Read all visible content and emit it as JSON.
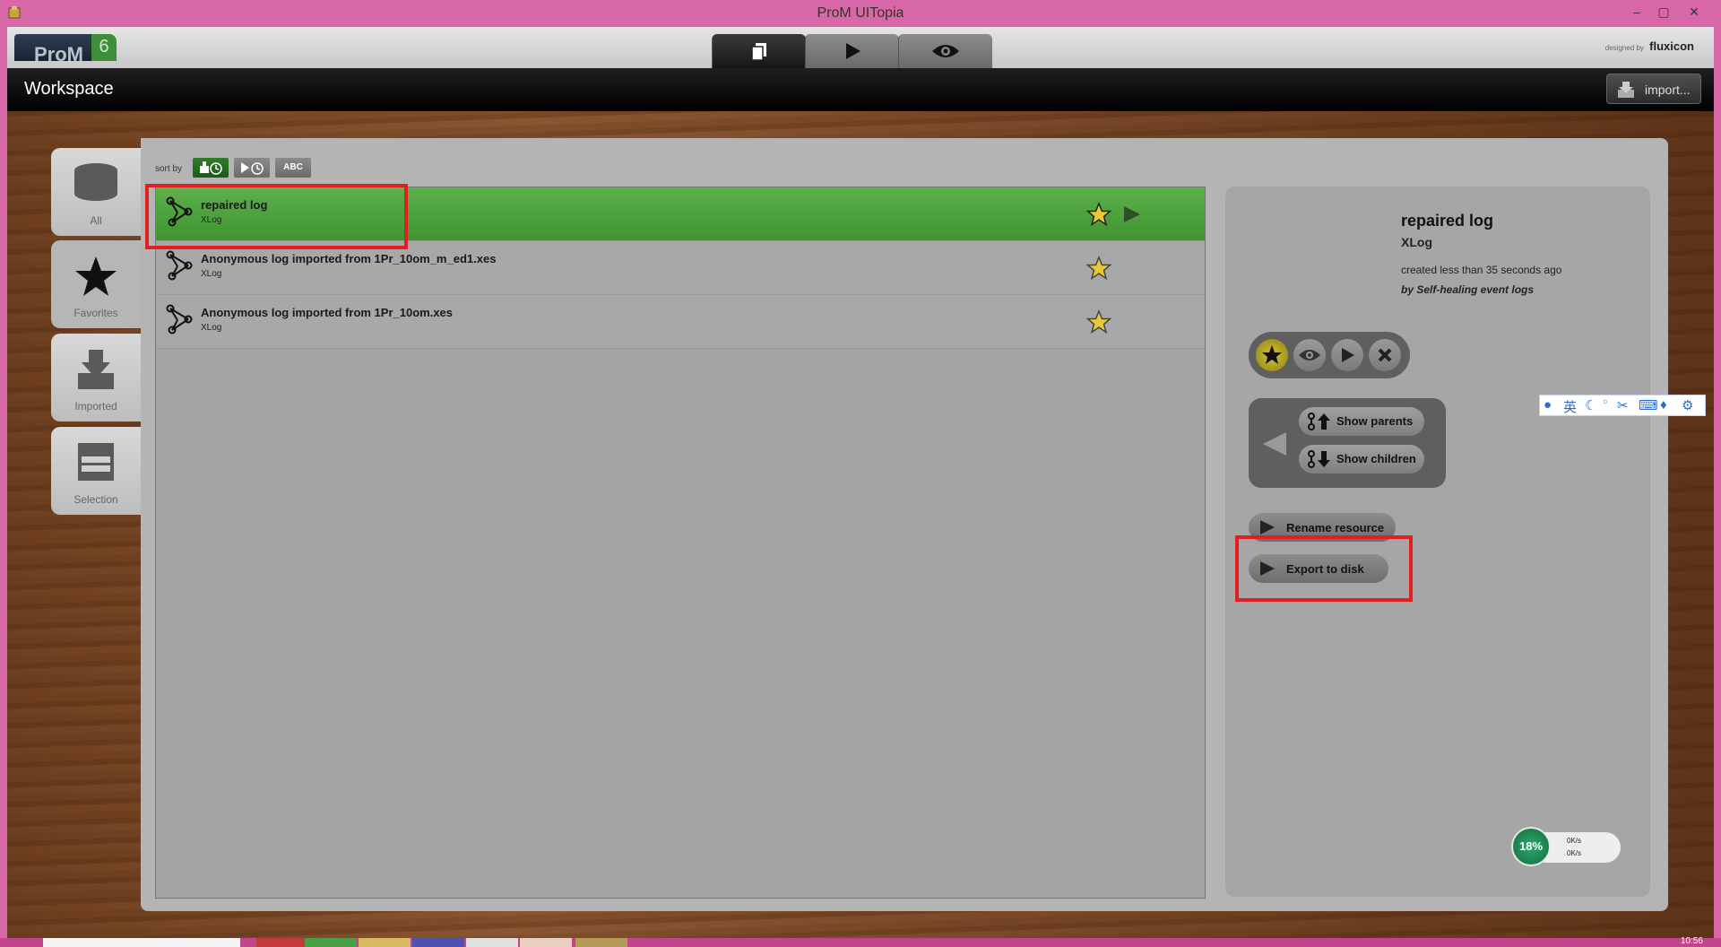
{
  "window": {
    "title": "ProM UITopia",
    "controls": [
      "–",
      "▢",
      "✕"
    ]
  },
  "header": {
    "logo_text": "ProM",
    "logo_version": "6",
    "designed_by": "designed by",
    "brand": "fluxicon",
    "mode_tabs": [
      {
        "name": "workspace",
        "icon": "documents-icon",
        "active": true
      },
      {
        "name": "actions",
        "icon": "play-icon",
        "active": false
      },
      {
        "name": "views",
        "icon": "eye-icon",
        "active": false
      }
    ]
  },
  "workspace_bar": {
    "title": "Workspace",
    "import_label": "import..."
  },
  "side_tabs": [
    {
      "label": "All",
      "icon": "database-icon",
      "active": false
    },
    {
      "label": "Favorites",
      "icon": "star-icon",
      "active": true
    },
    {
      "label": "Imported",
      "icon": "import-icon",
      "active": false
    },
    {
      "label": "Selection",
      "icon": "selection-icon",
      "active": false
    }
  ],
  "sort": {
    "label": "sort by",
    "options": [
      {
        "label": "",
        "icon": "import-time-icon",
        "active": true
      },
      {
        "label": "",
        "icon": "play-time-icon",
        "active": false
      },
      {
        "label": "ABC",
        "icon": "",
        "active": false
      }
    ]
  },
  "resources": [
    {
      "name": "repaired log",
      "type": "XLog",
      "favorite": true,
      "selected": true
    },
    {
      "name": "Anonymous log imported from 1Pr_10om_m_ed1.xes",
      "type": "XLog",
      "favorite": true,
      "selected": false
    },
    {
      "name": "Anonymous log imported from 1Pr_10om.xes",
      "type": "XLog",
      "favorite": true,
      "selected": false
    }
  ],
  "detail": {
    "name": "repaired log",
    "type": "XLog",
    "created": "created less than 35 seconds ago",
    "by": "by Self-healing event logs",
    "show_parents": "Show parents",
    "show_children": "Show children",
    "rename": "Rename resource",
    "export": "Export to disk"
  },
  "ime_toolbar": {
    "lang": "英"
  },
  "net_monitor": {
    "percent": "18%",
    "up": "0K/s",
    "down": "0K/s"
  },
  "taskbar": {
    "time": "10:56"
  },
  "colors": {
    "accent_green": "#4ea33d",
    "highlight_red": "#e02020",
    "window_border": "#d867a7"
  }
}
